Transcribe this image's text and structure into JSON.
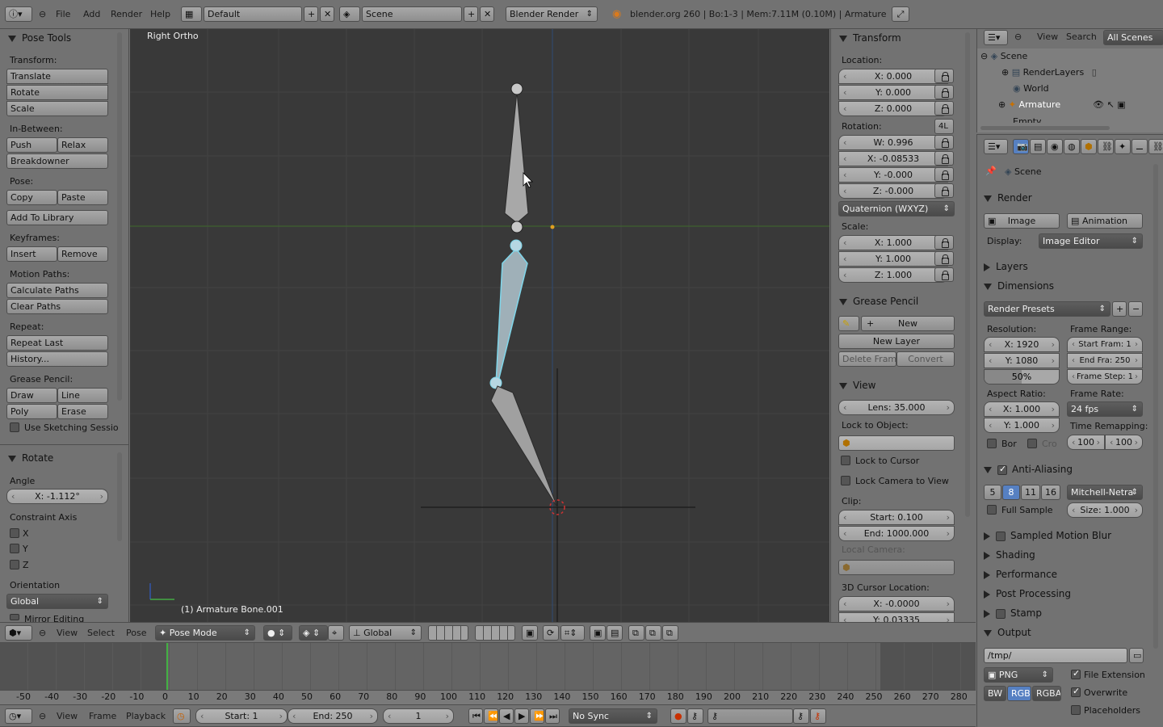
{
  "topbar": {
    "menus": [
      "File",
      "Add",
      "Render",
      "Help"
    ],
    "layout": "Default",
    "scene": "Scene",
    "engine": "Blender Render",
    "info": "blender.org 260 | Bo:1-3  | Mem:7.11M (0.10M) | Armature"
  },
  "toolshelf": {
    "title": "Pose Tools",
    "transform_label": "Transform:",
    "translate": "Translate",
    "rotate": "Rotate",
    "scale": "Scale",
    "inbetween_label": "In-Between:",
    "push": "Push",
    "relax": "Relax",
    "breakdowner": "Breakdowner",
    "pose_label": "Pose:",
    "copy": "Copy",
    "paste": "Paste",
    "add_library": "Add To Library",
    "keyframes_label": "Keyframes:",
    "insert": "Insert",
    "remove": "Remove",
    "motion_label": "Motion Paths:",
    "calc_paths": "Calculate Paths",
    "clear_paths": "Clear Paths",
    "repeat_label": "Repeat:",
    "repeat_last": "Repeat Last",
    "history": "History...",
    "grease_label": "Grease Pencil:",
    "draw": "Draw",
    "line": "Line",
    "poly": "Poly",
    "erase": "Erase",
    "sketching": "Use Sketching Sessio",
    "op_title": "Rotate",
    "angle_label": "Angle",
    "angle_value": "X: -1.112°",
    "constraint_label": "Constraint Axis",
    "axis_x": "X",
    "axis_y": "Y",
    "axis_z": "Z",
    "orientation_label": "Orientation",
    "orientation_value": "Global",
    "mirror": "Mirror Editing"
  },
  "viewport": {
    "view_name": "Right Ortho",
    "object_info": "(1) Armature Bone.001"
  },
  "nprops": {
    "transform_title": "Transform",
    "location_label": "Location:",
    "loc": [
      "X: 0.000",
      "Y: 0.000",
      "Z: 0.000"
    ],
    "rotation_label": "Rotation:",
    "rot_lock": "4L",
    "rot": [
      "W: 0.996",
      "X: -0.08533",
      "Y: -0.000",
      "Z: -0.000"
    ],
    "rot_mode": "Quaternion (WXYZ)",
    "scale_label": "Scale:",
    "scl": [
      "X: 1.000",
      "Y: 1.000",
      "Z: 1.000"
    ],
    "grease_title": "Grease Pencil",
    "gp_new": "New",
    "gp_new_layer": "New Layer",
    "gp_delete": "Delete Frame",
    "gp_convert": "Convert",
    "view_title": "View",
    "lens": "Lens: 35.000",
    "lock_obj_label": "Lock to Object:",
    "lock_cursor": "Lock to Cursor",
    "lock_camera": "Lock Camera to View",
    "clip_label": "Clip:",
    "clip_start": "Start: 0.100",
    "clip_end": "End: 1000.000",
    "local_camera": "Local Camera:",
    "cursor_label": "3D Cursor Location:",
    "cursor_x": "X: -0.0000",
    "cursor_y": "Y: 0.03335"
  },
  "outliner": {
    "view": "View",
    "search": "Search",
    "all_scenes": "All Scenes",
    "items": [
      "Scene",
      "RenderLayers",
      "World",
      "Armature",
      "Empty"
    ]
  },
  "properties": {
    "context": "Scene",
    "render_title": "Render",
    "image": "Image",
    "animation": "Animation",
    "display_label": "Display:",
    "display_value": "Image Editor",
    "layers": "Layers",
    "dimensions": "Dimensions",
    "presets": "Render Presets",
    "resolution_label": "Resolution:",
    "res_x": "X: 1920",
    "res_y": "Y: 1080",
    "res_pct": "50%",
    "frame_range_label": "Frame Range:",
    "start_frame": "Start Fram: 1",
    "end_frame": "End Fra: 250",
    "frame_step": "Frame Step: 1",
    "aspect_label": "Aspect Ratio:",
    "asp_x": "X: 1.000",
    "asp_y": "Y: 1.000",
    "frame_rate_label": "Frame Rate:",
    "fps": "24 fps",
    "remap_label": "Time Remapping:",
    "remap_old": "100",
    "remap_new": "100",
    "bor": "Bor",
    "cro": "Cro",
    "aa": "Anti-Aliasing",
    "aa_samples": [
      "5",
      "8",
      "11",
      "16"
    ],
    "aa_filter": "Mitchell-Netra",
    "full_sample": "Full Sample",
    "aa_size": "Size: 1.000",
    "motion_blur": "Sampled Motion Blur",
    "shading": "Shading",
    "performance": "Performance",
    "post": "Post Processing",
    "stamp": "Stamp",
    "output": "Output",
    "path": "/tmp/",
    "format": "PNG",
    "file_ext": "File Extension",
    "bw": "BW",
    "rgb": "RGB",
    "rgba": "RGBA",
    "overwrite": "Overwrite",
    "placeholders": "Placeholders"
  },
  "view3d_header": {
    "view": "View",
    "select": "Select",
    "pose": "Pose",
    "mode": "Pose Mode",
    "orientation": "Global"
  },
  "timeline": {
    "ticks": [
      "-50",
      "-40",
      "-30",
      "-20",
      "-10",
      "0",
      "10",
      "20",
      "30",
      "40",
      "50",
      "60",
      "70",
      "80",
      "90",
      "100",
      "110",
      "120",
      "130",
      "140",
      "150",
      "160",
      "170",
      "180",
      "190",
      "200",
      "210",
      "220",
      "230",
      "240",
      "250",
      "260",
      "270",
      "280"
    ],
    "view": "View",
    "frame": "Frame",
    "playback": "Playback",
    "start": "Start: 1",
    "end": "End: 250",
    "current": "1",
    "sync": "No Sync"
  }
}
